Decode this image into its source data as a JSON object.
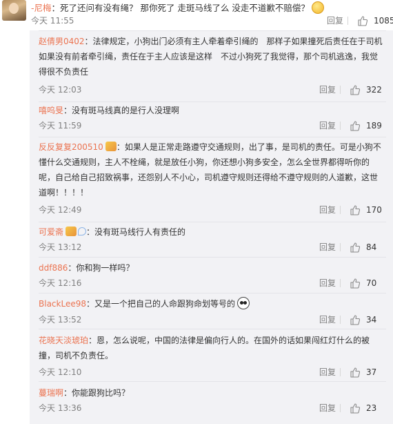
{
  "top_comment": {
    "user": "-尼梅",
    "text": "：死了还问有没有绳？ 那你死了 走斑马线了么 没走不道歉不赔偿？",
    "emoji": "thinking-face-emoji",
    "time": "今天 11:55",
    "reply_label": "回复",
    "likes": "1085"
  },
  "replies": [
    {
      "user": "赵倩男0402",
      "lines": [
        "：法律规定，小狗出门必须有主人牵着牵引绳的　那样子如果撞死后责任在于司机",
        "如果没有前者牵引绳，责任在于主人应该是这样　不过小狗死了我觉得，那个司机逃逸，我觉",
        "得很不负责任"
      ],
      "time": "今天 12:03",
      "reply_label": "回复",
      "likes": "322"
    },
    {
      "user": "嘻呜旻",
      "lines": [
        "：没有斑马线真的是行人没理啊"
      ],
      "time": "今天 11:59",
      "reply_label": "回复",
      "likes": "189"
    },
    {
      "user": "反反复复200510",
      "lines": [
        "：如果人是正常走路遵守交通规则，出了事，是司机的责任。可是小狗不",
        "懂什么交通规则，主人不栓绳，就是放任小狗，你还想小狗多安全，怎么全世界都得听你的",
        "呢，自己给自己招致祸事，还怨别人不小心，司机遵守规则还得给不遵守规则的人道歉，这世",
        "道啊！！！！"
      ],
      "time": "今天 12:49",
      "reply_label": "回复",
      "likes": "170"
    },
    {
      "user": "可爱斋",
      "lines": [
        "：没有斑马线行人有责任的"
      ],
      "time": "今天 13:12",
      "reply_label": "回复",
      "likes": "84"
    },
    {
      "user": "ddf886",
      "lines": [
        "：你和狗一样吗？"
      ],
      "time": "今天 12:16",
      "reply_label": "回复",
      "likes": "70"
    },
    {
      "user": "BlackLee98",
      "lines": [
        "：又是一个把自己的人命跟狗命划等号的"
      ],
      "time": "今天 13:52",
      "reply_label": "回复",
      "likes": "34"
    },
    {
      "user": "花晓天淡琥珀",
      "lines": [
        "：恩，怎么说呢，中国的法律是偏向行人的。在国外的话如果闯红灯什么的被",
        "撞，司机不负责任。"
      ],
      "time": "今天 12:10",
      "reply_label": "回复",
      "likes": "37"
    },
    {
      "user": "蔓瑞啊",
      "lines": [
        "：你能跟狗比吗？"
      ],
      "time": "今天 13:36",
      "reply_label": "回复",
      "likes": "23"
    }
  ]
}
